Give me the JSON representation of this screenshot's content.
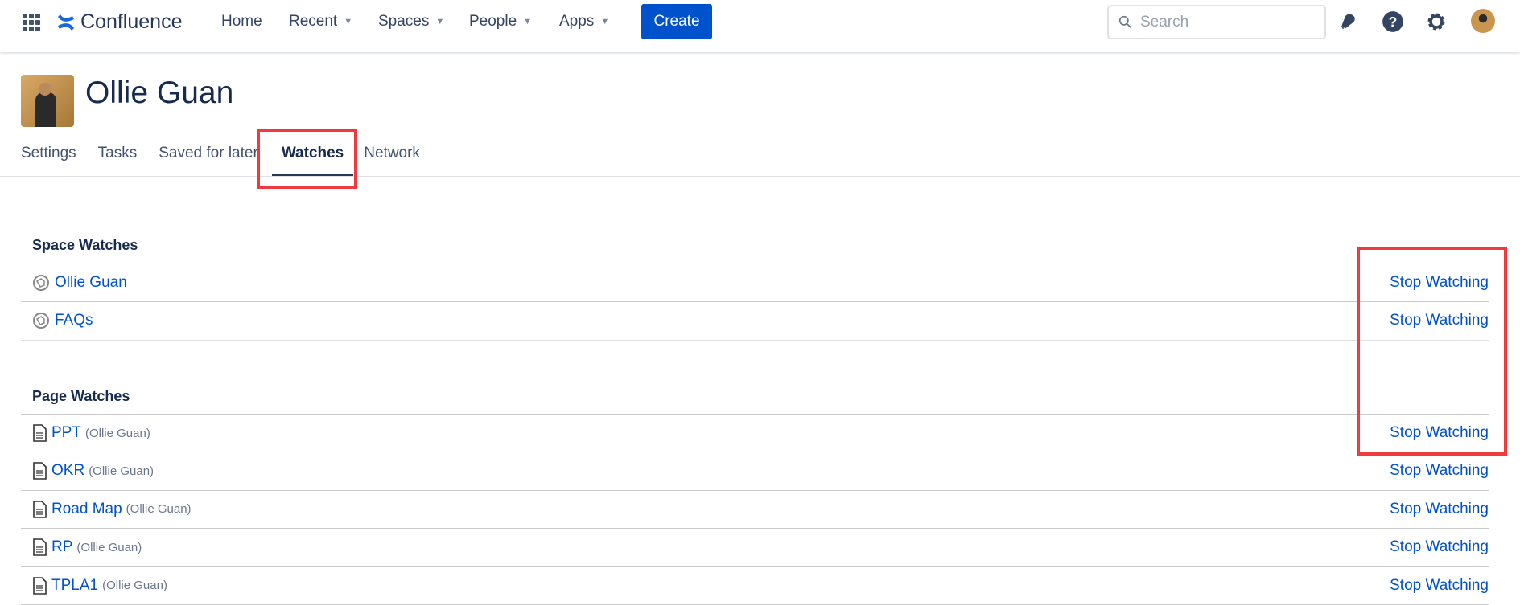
{
  "nav": {
    "logo": "Confluence",
    "items": [
      {
        "label": "Home"
      },
      {
        "label": "Recent",
        "dropdown": true
      },
      {
        "label": "Spaces",
        "dropdown": true
      },
      {
        "label": "People",
        "dropdown": true
      },
      {
        "label": "Apps",
        "dropdown": true
      }
    ],
    "create": "Create",
    "search_placeholder": "Search"
  },
  "profile": {
    "name": "Ollie Guan"
  },
  "tabs": [
    {
      "label": "Settings"
    },
    {
      "label": "Tasks"
    },
    {
      "label": "Saved for later"
    },
    {
      "label": "Watches",
      "active": true
    },
    {
      "label": "Network"
    }
  ],
  "space_watches": {
    "heading": "Space Watches",
    "items": [
      {
        "name": "Ollie Guan",
        "action": "Stop Watching"
      },
      {
        "name": "FAQs",
        "action": "Stop Watching"
      }
    ]
  },
  "page_watches": {
    "heading": "Page Watches",
    "items": [
      {
        "name": "PPT",
        "space": "(Ollie Guan)",
        "action": "Stop Watching"
      },
      {
        "name": "OKR",
        "space": "(Ollie Guan)",
        "action": "Stop Watching"
      },
      {
        "name": "Road Map",
        "space": "(Ollie Guan)",
        "action": "Stop Watching"
      },
      {
        "name": "RP",
        "space": "(Ollie Guan)",
        "action": "Stop Watching"
      },
      {
        "name": "TPLA1",
        "space": "(Ollie Guan)",
        "action": "Stop Watching"
      }
    ]
  },
  "colors": {
    "accent": "#0052cc",
    "highlight": "#f03a3d"
  }
}
